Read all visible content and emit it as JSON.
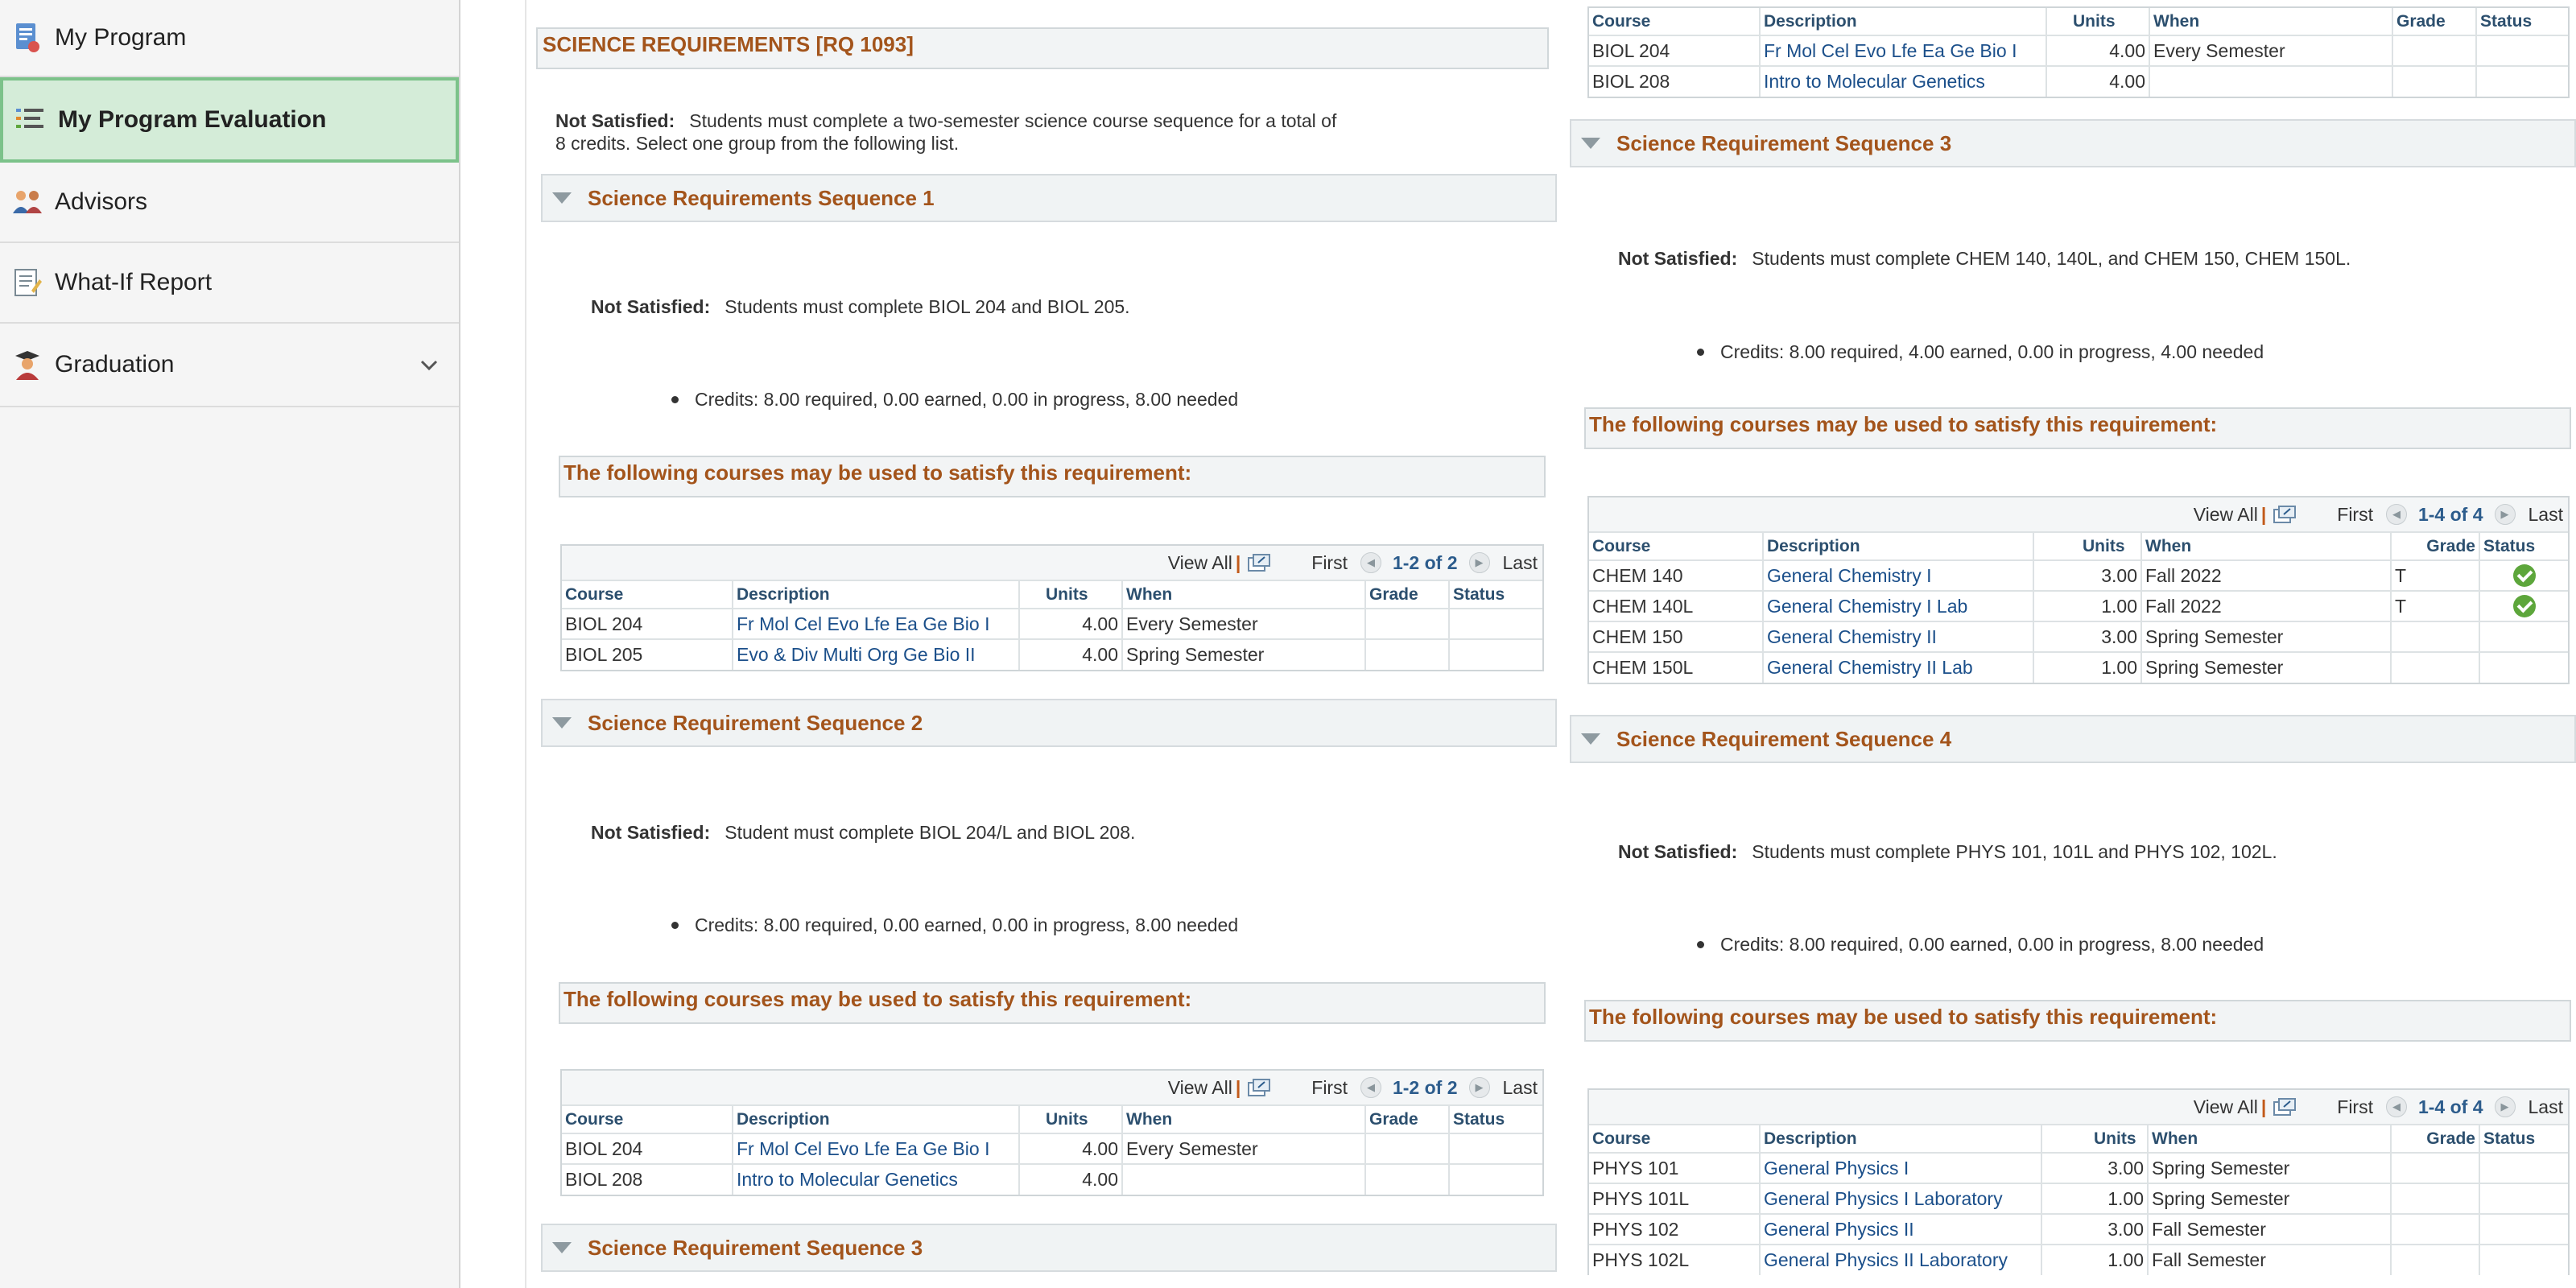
{
  "sidebar": {
    "items": [
      {
        "label": "My Program",
        "icon": "document-icon"
      },
      {
        "label": "My Program Evaluation",
        "icon": "checklist-icon",
        "active": true
      },
      {
        "label": "Advisors",
        "icon": "people-icon"
      },
      {
        "label": "What-If Report",
        "icon": "notepad-icon"
      },
      {
        "label": "Graduation",
        "icon": "graduate-icon",
        "expandable": true
      }
    ]
  },
  "colors": {
    "accent": "#a3541b",
    "link": "#1b4f8a",
    "active_bg": "#d4ecd8",
    "active_border": "#7cc28a",
    "check": "#5da63b"
  },
  "requirement": {
    "title": "SCIENCE REQUIREMENTS [RQ 1093]",
    "status_label": "Not Satisfied:",
    "status_text_1": "Students must complete a two-semester science course sequence for a total of",
    "status_text_2": "8 credits. Select one group from the following list."
  },
  "common": {
    "following": "The following courses may be used to satisfy this requirement:",
    "view_all": "View All",
    "first": "First",
    "last": "Last",
    "not_satisfied": "Not Satisfied:"
  },
  "columns": {
    "course": "Course",
    "description": "Description",
    "units": "Units",
    "when": "When",
    "grade": "Grade",
    "status": "Status"
  },
  "seq1": {
    "title": "Science Requirements Sequence 1",
    "status_text": "Students must complete BIOL 204 and BIOL 205.",
    "credits": "Credits: 8.00 required, 0.00 earned, 0.00 in progress, 8.00 needed",
    "count": "1-2 of 2",
    "rows": [
      {
        "course": "BIOL 204",
        "description": "Fr Mol Cel Evo Lfe Ea Ge Bio I",
        "units": "4.00",
        "when": "Every Semester",
        "grade": "",
        "status": ""
      },
      {
        "course": "BIOL 205",
        "description": "Evo & Div Multi Org Ge Bio II",
        "units": "4.00",
        "when": "Spring Semester",
        "grade": "",
        "status": ""
      }
    ]
  },
  "seq2": {
    "title": "Science Requirement Sequence 2",
    "status_text": "Student must complete BIOL 204/L and BIOL 208.",
    "credits": "Credits: 8.00 required, 0.00 earned, 0.00 in progress, 8.00 needed",
    "count": "1-2 of 2",
    "rows": [
      {
        "course": "BIOL 204",
        "description": "Fr Mol Cel Evo Lfe Ea Ge Bio I",
        "units": "4.00",
        "when": "Every Semester",
        "grade": "",
        "status": ""
      },
      {
        "course": "BIOL 208",
        "description": "Intro to Molecular Genetics",
        "units": "4.00",
        "when": "",
        "grade": "",
        "status": ""
      }
    ]
  },
  "seq3": {
    "title": "Science Requirement Sequence 3",
    "status_text": "Students must complete CHEM 140, 140L, and CHEM 150, CHEM 150L.",
    "credits": "Credits: 8.00 required, 4.00 earned, 0.00 in progress, 4.00 needed",
    "count": "1-4 of 4",
    "rows": [
      {
        "course": "CHEM 140",
        "description": "General Chemistry I",
        "units": "3.00",
        "when": "Fall 2022",
        "grade": "T",
        "status": "check"
      },
      {
        "course": "CHEM 140L",
        "description": "General Chemistry I Lab",
        "units": "1.00",
        "when": "Fall 2022",
        "grade": "T",
        "status": "check"
      },
      {
        "course": "CHEM 150",
        "description": "General Chemistry II",
        "units": "3.00",
        "when": "Spring Semester",
        "grade": "",
        "status": ""
      },
      {
        "course": "CHEM 150L",
        "description": "General Chemistry II Lab",
        "units": "1.00",
        "when": "Spring Semester",
        "grade": "",
        "status": ""
      }
    ]
  },
  "seq4": {
    "title": "Science Requirement Sequence 4",
    "status_text": "Students must complete PHYS 101, 101L and PHYS 102, 102L.",
    "credits": "Credits: 8.00 required, 0.00 earned, 0.00 in progress, 8.00 needed",
    "count": "1-4 of 4",
    "rows": [
      {
        "course": "PHYS 101",
        "description": "General Physics I",
        "units": "3.00",
        "when": "Spring Semester",
        "grade": "",
        "status": ""
      },
      {
        "course": "PHYS 101L",
        "description": "General Physics I Laboratory",
        "units": "1.00",
        "when": "Spring Semester",
        "grade": "",
        "status": ""
      },
      {
        "course": "PHYS 102",
        "description": "General Physics II",
        "units": "3.00",
        "when": "Fall Semester",
        "grade": "",
        "status": ""
      },
      {
        "course": "PHYS 102L",
        "description": "General Physics II Laboratory",
        "units": "1.00",
        "when": "Fall Semester",
        "grade": "",
        "status": ""
      }
    ]
  }
}
